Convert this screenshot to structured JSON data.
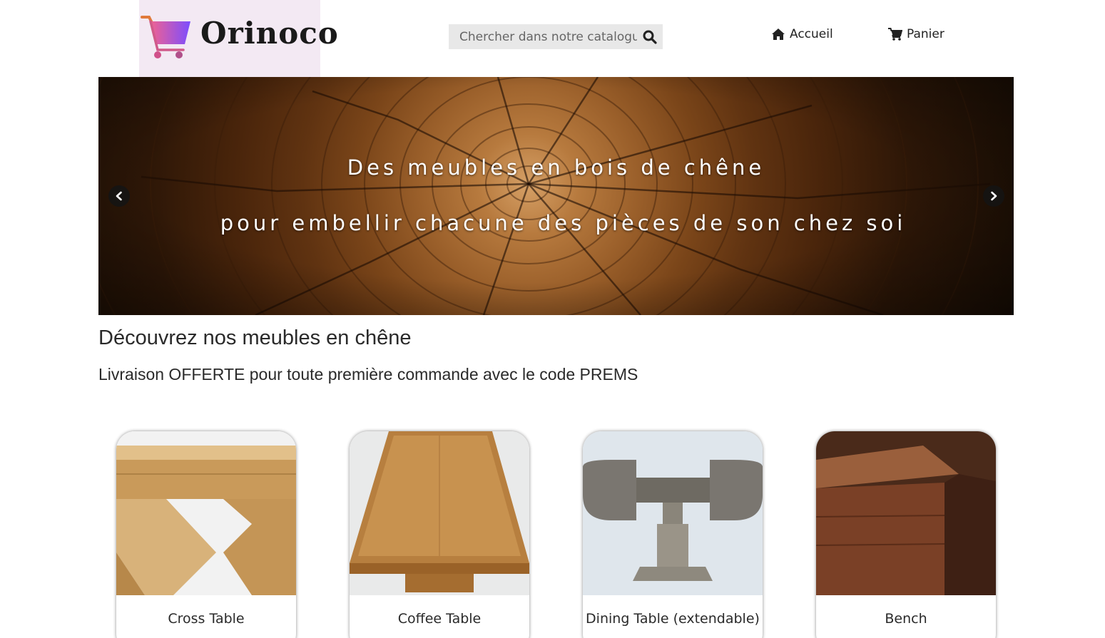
{
  "header": {
    "logo_text": "Orinoco",
    "search": {
      "placeholder": "Chercher dans notre catalogue"
    },
    "nav": [
      {
        "label": "Accueil",
        "icon": "home-icon"
      },
      {
        "label": "Panier",
        "icon": "shopping-cart-icon"
      }
    ]
  },
  "hero": {
    "line1": "Des meubles en bois de chêne",
    "line2": "pour embellir chacune des pièces de son chez soi"
  },
  "main": {
    "title": "Découvrez nos meubles en chêne",
    "promo": "Livraison OFFERTE pour toute première commande avec le code PREMS",
    "products": [
      {
        "name": "Cross Table"
      },
      {
        "name": "Coffee Table"
      },
      {
        "name": "Dining Table (extendable)"
      },
      {
        "name": "Bench"
      }
    ]
  },
  "colors": {
    "logo_background": "#f3e9f3",
    "search_background": "#e8e8e8",
    "cart_gradient_start": "#e05aa0",
    "cart_gradient_end": "#7a5cf0"
  }
}
